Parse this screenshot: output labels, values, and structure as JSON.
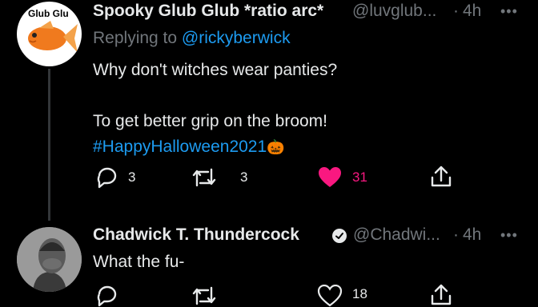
{
  "tweets": [
    {
      "avatar_label": "Glub Glu",
      "display_name": "Spooky Glub Glub *ratio arc*",
      "handle": "@luvglub...",
      "separator": "·",
      "time": "4h",
      "replying_prefix": "Replying to",
      "replying_to": "@rickyberwick",
      "text_line1": "Why don't witches wear panties?",
      "text_line2": "To get better grip on the broom!",
      "hashtag": "#HappyHalloween2021",
      "emoji": "🎃",
      "reply_count": "3",
      "retweet_count": "3",
      "like_count": "31",
      "liked": true,
      "more_label": "•••"
    },
    {
      "display_name": "Chadwick T. Thundercock",
      "handle": "@Chadwi...",
      "separator": "·",
      "time": "4h",
      "text": "What the fu-",
      "like_count": "18",
      "more_label": "•••"
    }
  ],
  "colors": {
    "background": "#000000",
    "text": "#e7e9ea",
    "muted": "#71767b",
    "link": "#1d9bf0",
    "like": "#f91880"
  }
}
